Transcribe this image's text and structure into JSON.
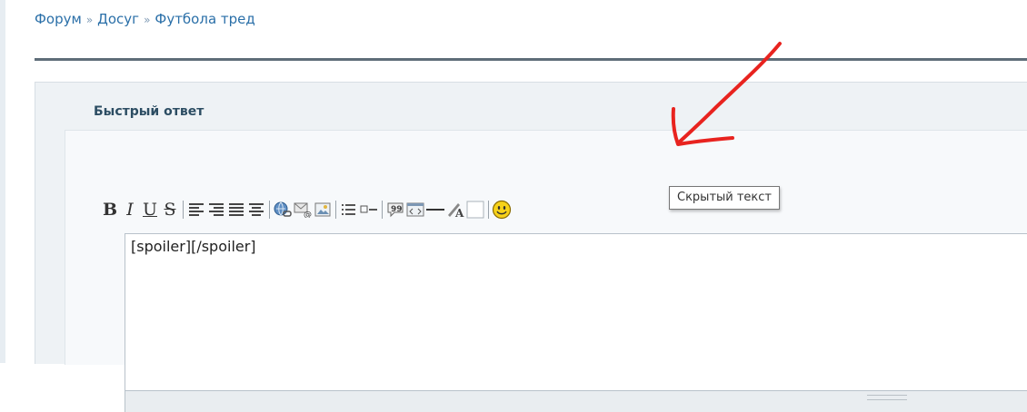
{
  "breadcrumb": {
    "items": [
      "Форум",
      "Досуг",
      "Футбола тред"
    ],
    "separator": "»"
  },
  "quick_reply": {
    "title": "Быстрый ответ"
  },
  "toolbar": {
    "buttons": [
      {
        "name": "bold",
        "label": "B"
      },
      {
        "name": "italic",
        "label": "I"
      },
      {
        "name": "underline",
        "label": "U"
      },
      {
        "name": "strikethrough",
        "label": "S"
      },
      {
        "name": "align-left",
        "icon": "align-left-icon"
      },
      {
        "name": "align-right",
        "icon": "align-right-icon"
      },
      {
        "name": "justify",
        "icon": "justify-icon"
      },
      {
        "name": "align-center",
        "icon": "align-center-icon"
      },
      {
        "name": "link",
        "icon": "link-icon"
      },
      {
        "name": "email",
        "icon": "email-icon"
      },
      {
        "name": "image",
        "icon": "image-icon"
      },
      {
        "name": "list",
        "icon": "list-icon"
      },
      {
        "name": "list-item",
        "icon": "list-item-icon"
      },
      {
        "name": "quote",
        "icon": "quote-icon"
      },
      {
        "name": "code",
        "icon": "code-icon"
      },
      {
        "name": "horizontal-rule",
        "icon": "hr-icon"
      },
      {
        "name": "font-color",
        "icon": "font-color-icon"
      },
      {
        "name": "hidden-text",
        "icon": "blank-square-icon"
      },
      {
        "name": "emoticons",
        "icon": "smiley-icon"
      }
    ]
  },
  "editor": {
    "value": "[spoiler][/spoiler]"
  },
  "tooltip": {
    "text": "Скрытый текст"
  },
  "colors": {
    "link": "#2a6fa8",
    "title": "#2c4d63",
    "annotation": "#e8231f"
  }
}
